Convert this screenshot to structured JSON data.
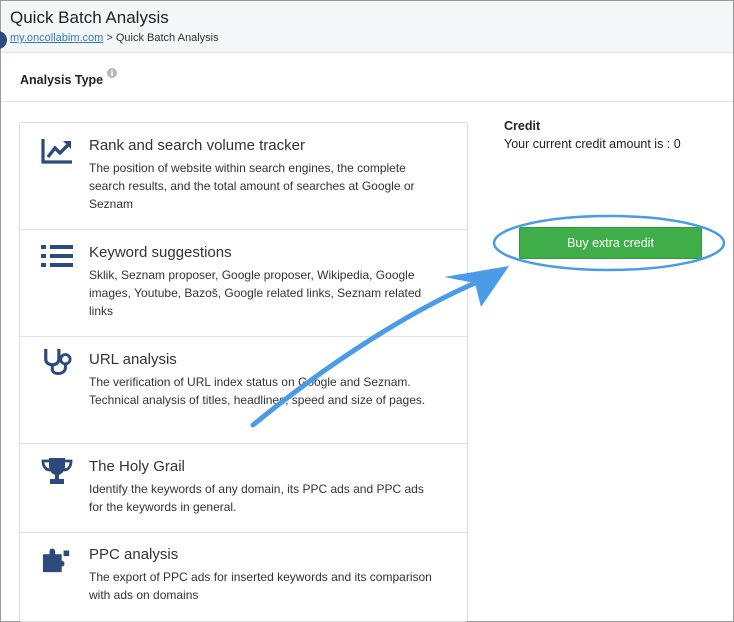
{
  "page": {
    "title": "Quick Batch Analysis",
    "breadcrumb": {
      "link": "my.oncollabim.com",
      "separator": " > ",
      "current": "Quick Batch Analysis"
    }
  },
  "section": {
    "title": "Analysis Type",
    "info_icon": "i"
  },
  "analysis_types": [
    {
      "icon": "trend-chart-icon",
      "title": "Rank and search volume tracker",
      "description": "The position of website within search engines, the complete search results, and the total amount of searches at Google or Seznam"
    },
    {
      "icon": "list-icon",
      "title": "Keyword suggestions",
      "description": "Sklik, Seznam proposer, Google proposer, Wikipedia, Google images, Youtube, Bazoš, Google related links, Seznam related links"
    },
    {
      "icon": "stethoscope-icon",
      "title": "URL analysis",
      "description": "The verification of URL index status on Google and Seznam. Technical analysis of titles, headlines, speed and size of pages."
    },
    {
      "icon": "trophy-icon",
      "title": "The Holy Grail",
      "description": "Identify the keywords of any domain, its PPC ads and PPC ads for the keywords in general."
    },
    {
      "icon": "puzzle-icon",
      "title": "PPC analysis",
      "description": "The export of PPC ads for inserted keywords and its comparison with ads on domains"
    }
  ],
  "credit": {
    "title": "Credit",
    "text": "Your current credit amount is : 0",
    "buy_button": "Buy extra credit"
  },
  "colors": {
    "icon_blue": "#2c4a7c",
    "button_green": "#3fae49",
    "annotation_blue": "#4a9be8"
  }
}
